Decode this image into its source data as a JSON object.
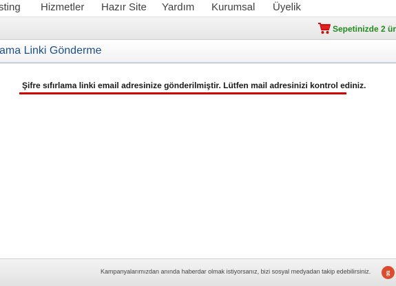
{
  "nav": {
    "items": [
      "sting",
      "Hizmetler",
      "Hazır Site",
      "Yardım",
      "Kurumsal",
      "Üyelik"
    ]
  },
  "cart": {
    "label": "Sepetinizde 2 ürü",
    "icon": "shopping-cart-icon",
    "color": "#22891e"
  },
  "page": {
    "title": "ama Linki Gönderme",
    "message": "Şifre sıfırlama linki email adresinize gönderilmiştir. Lütfen mail adresinizi kontrol ediniz."
  },
  "footer": {
    "text": "Kampanyalarımızdan anında haberdar olmak istiyorsanız, bizi sosyal medyadan takip edebilirsiniz.",
    "social_icon": "google-plus-icon",
    "social_glyph": "g"
  },
  "colors": {
    "title": "#1e4f8c",
    "highlight_line": "#d40000",
    "social": "#dd4b2d"
  }
}
